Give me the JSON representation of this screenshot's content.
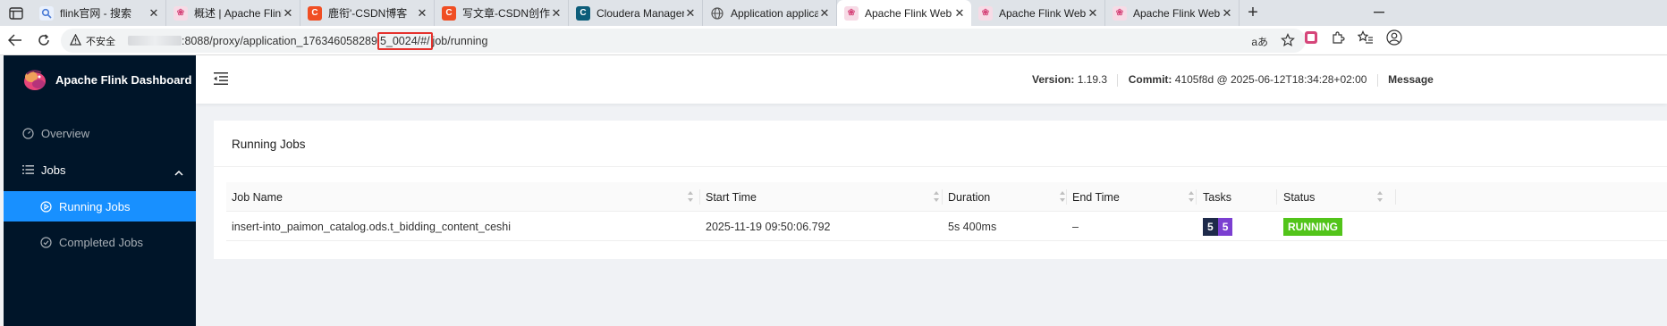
{
  "browser": {
    "tabs": [
      {
        "title": "flink官网 - 搜索",
        "icon": "search-favicon",
        "color": "#4a7bd6",
        "active": false
      },
      {
        "title": "概述 | Apache Flink --- n",
        "icon": "flink-favicon",
        "color": "#d6467a",
        "active": false
      },
      {
        "title": "鹿衔'-CSDN博客",
        "icon": "csdn-favicon",
        "color": "#f04e23",
        "active": false
      },
      {
        "title": "写文章-CSDN创作中心",
        "icon": "csdn-favicon",
        "color": "#f04e23",
        "active": false
      },
      {
        "title": "Cloudera Manager",
        "icon": "cloudera-favicon",
        "color": "#0d5d7a",
        "active": false
      },
      {
        "title": "Application application",
        "icon": "globe-favicon",
        "color": "#555555",
        "active": false
      },
      {
        "title": "Apache Flink Web Dash",
        "icon": "flink-favicon",
        "color": "#d6467a",
        "active": true
      },
      {
        "title": "Apache Flink Web Dash",
        "icon": "flink-favicon",
        "color": "#d6467a",
        "active": false
      },
      {
        "title": "Apache Flink Web Dash",
        "icon": "flink-favicon",
        "color": "#d6467a",
        "active": false
      }
    ],
    "security_label": "不安全",
    "url_part1": ":8088/proxy/application_176346058289",
    "url_highlight": "5_0024/#/",
    "url_part2": "job/running",
    "reader_label": "aあ"
  },
  "sidebar": {
    "brand": "Apache Flink Dashboard",
    "items": [
      {
        "label": "Overview",
        "icon": "dashboard-icon"
      },
      {
        "label": "Jobs",
        "icon": "list-icon"
      },
      {
        "label": "Running Jobs",
        "icon": "play-circle-icon"
      },
      {
        "label": "Completed Jobs",
        "icon": "check-circle-icon"
      }
    ]
  },
  "header": {
    "version_label": "Version:",
    "version_value": "1.19.3",
    "commit_label": "Commit:",
    "commit_value": "4105f8d @ 2025-06-12T18:34:28+02:00",
    "message_label": "Message"
  },
  "card": {
    "title": "Running Jobs",
    "columns": [
      "Job Name",
      "Start Time",
      "Duration",
      "End Time",
      "Tasks",
      "Status"
    ],
    "rows": [
      {
        "job_name": "insert-into_paimon_catalog.ods.t_bidding_content_ceshi",
        "start_time": "2025-11-19 09:50:06.792",
        "duration": "5s 400ms",
        "end_time": "–",
        "tasks_total": "5",
        "tasks_running": "5",
        "status": "RUNNING"
      }
    ]
  },
  "colors": {
    "sidebar_bg": "#001529",
    "selected": "#1890ff",
    "running": "#52c41a",
    "task_total": "#1e2a4a",
    "task_running": "#7b3fd1",
    "url_highlight": "#e5322d"
  }
}
